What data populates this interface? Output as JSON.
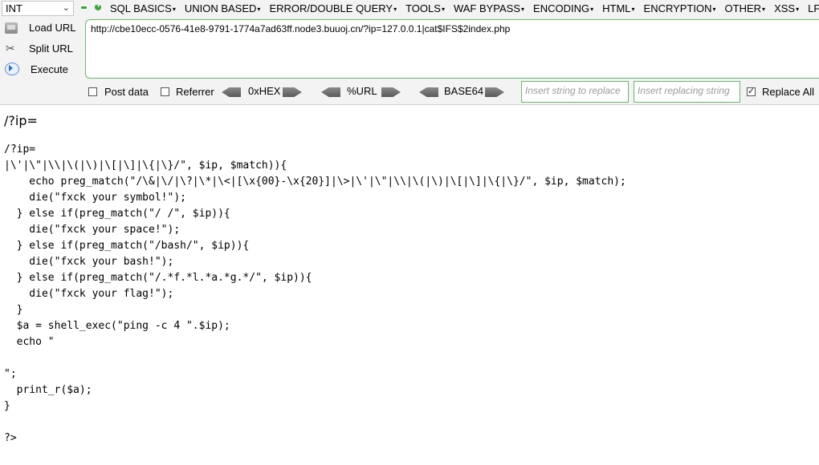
{
  "toolbar": {
    "select_value": "INT",
    "menus": [
      "SQL BASICS",
      "UNION BASED",
      "ERROR/DOUBLE QUERY",
      "TOOLS",
      "WAF BYPASS",
      "ENCODING",
      "HTML",
      "ENCRYPTION",
      "OTHER",
      "XSS",
      "LFI"
    ],
    "load_url": "Load URL",
    "split_url": "Split URL",
    "execute": "Execute",
    "url_value": "http://cbe10ecc-0576-41e8-9791-1774a7ad63ff.node3.buuoj.cn/?ip=127.0.0.1|cat$IFS$2index.php",
    "post_data": "Post data",
    "referrer": "Referrer",
    "hex": "0xHEX",
    "url_enc": "%URL",
    "base64": "BASE64",
    "insert_placeholder": "Insert string to replace",
    "replacing_placeholder": "Insert replacing string",
    "replace_all": "Replace All",
    "accent_color": "#6cb46c"
  },
  "page": {
    "heading": "/?ip=",
    "code": "/?ip=\n|\\'|\\\"|\\\\|\\(|\\)|\\[|\\]|\\{|\\}/\", $ip, $match)){\n    echo preg_match(\"/\\&|\\/|\\?|\\*|\\<|[\\x{00}-\\x{20}]|\\>|\\'|\\\"|\\\\|\\(|\\)|\\[|\\]|\\{|\\}/\", $ip, $match);\n    die(\"fxck your symbol!\");\n  } else if(preg_match(\"/ /\", $ip)){\n    die(\"fxck your space!\");\n  } else if(preg_match(\"/bash/\", $ip)){\n    die(\"fxck your bash!\");\n  } else if(preg_match(\"/.*f.*l.*a.*g.*/\", $ip)){\n    die(\"fxck your flag!\");\n  }\n  $a = shell_exec(\"ping -c 4 \".$ip);\n  echo \"\n\n\";\n  print_r($a);\n}\n\n?>"
  }
}
